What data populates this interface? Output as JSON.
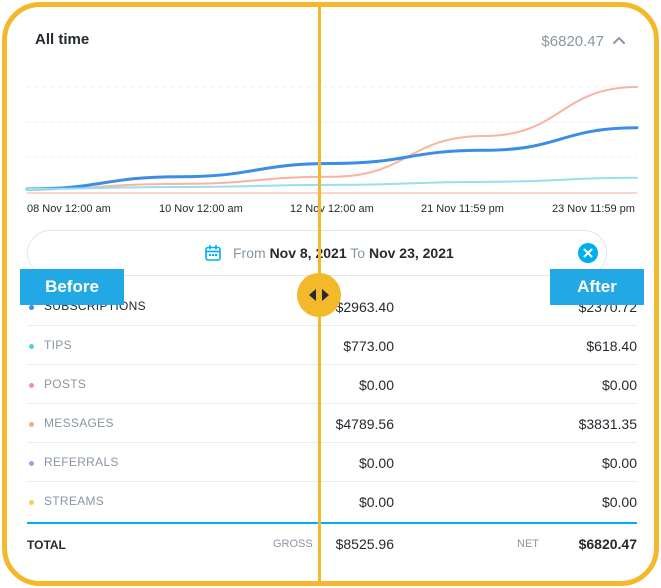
{
  "header": {
    "title": "All time",
    "total": "$6820.47",
    "collapse_icon": "chevron-up-icon"
  },
  "chart_data": {
    "type": "line",
    "x": [
      "08 Nov 12:00 am",
      "10 Nov 12:00 am",
      "12 Nov 12:00 am",
      "21 Nov 11:59 pm",
      "23 Nov 11:59 pm"
    ],
    "x_tick_labels": [
      "08 Nov 12:00 am",
      "10 Nov 12:00 am",
      "12 Nov 12:00 am",
      "21 Nov 11:59 pm",
      "23 Nov 11:59 pm"
    ],
    "grid": true,
    "series": [
      {
        "color": "#f9b4a0",
        "values": [
          0,
          0.05,
          0.12,
          0.52,
          1.0
        ]
      },
      {
        "color": "#3a8ee6",
        "values": [
          0,
          0.12,
          0.25,
          0.38,
          0.6
        ]
      },
      {
        "color": "#9ae0ea",
        "values": [
          0,
          0.02,
          0.04,
          0.07,
          0.11
        ]
      }
    ]
  },
  "date_range": {
    "from_label": "From",
    "from": "Nov 8, 2021",
    "to_label": "To",
    "to": "Nov 23, 2021"
  },
  "rows": [
    {
      "label": "SUBSCRIPTIONS",
      "color": "#3a8ee6",
      "gross": "$2963.40",
      "net": "$2370.72"
    },
    {
      "label": "TIPS",
      "color": "#4fd1e0",
      "gross": "$773.00",
      "net": "$618.40"
    },
    {
      "label": "POSTS",
      "color": "#f08cb4",
      "gross": "$0.00",
      "net": "$0.00"
    },
    {
      "label": "MESSAGES",
      "color": "#f9a88e",
      "gross": "$4789.56",
      "net": "$3831.35"
    },
    {
      "label": "REFERRALS",
      "color": "#a99ae6",
      "gross": "$0.00",
      "net": "$0.00"
    },
    {
      "label": "STREAMS",
      "color": "#f4cf55",
      "gross": "$0.00",
      "net": "$0.00"
    }
  ],
  "total": {
    "label": "TOTAL",
    "gross_label": "GROSS",
    "gross": "$8525.96",
    "net_label": "NET",
    "net": "$6820.47"
  },
  "overlay": {
    "before": "Before",
    "after": "After"
  }
}
